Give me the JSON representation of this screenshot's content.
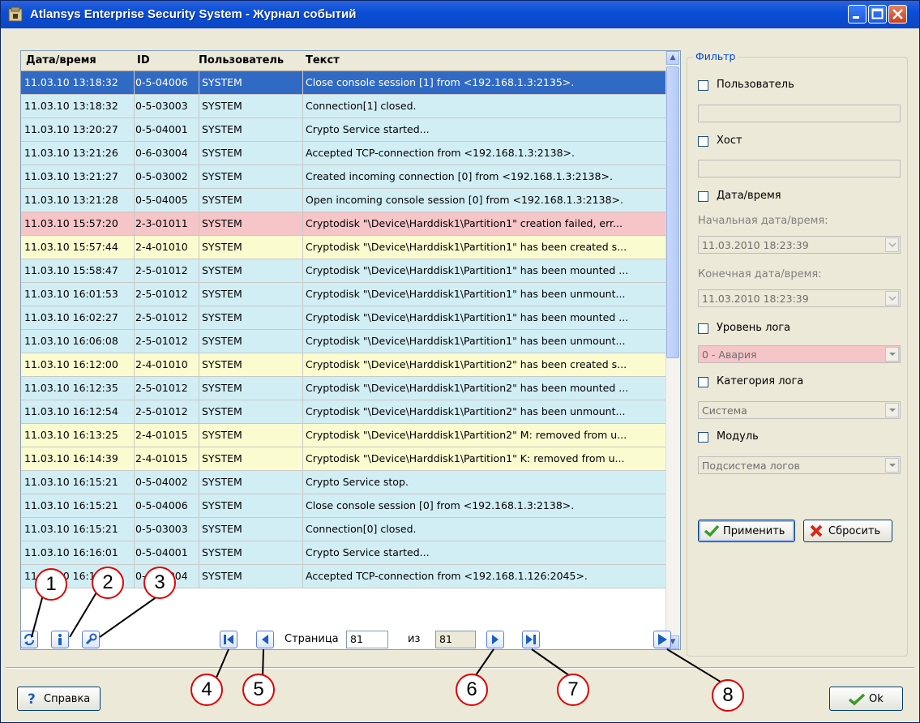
{
  "window": {
    "title": "Atlansys Enterprise Security System - Журнал событий",
    "icon": "app-icon"
  },
  "table": {
    "columns": [
      "Дата/время",
      "ID",
      "Пользователь",
      "Текст"
    ],
    "rows": [
      {
        "datetime": "11.03.10 13:18:32",
        "id": "0-5-04006",
        "user": "SYSTEM",
        "text": "Close console session [1] from <192.168.1.3:2135>.",
        "style": "selected"
      },
      {
        "datetime": "11.03.10 13:18:32",
        "id": "0-5-03003",
        "user": "SYSTEM",
        "text": "Connection[1] closed.",
        "style": "cyan"
      },
      {
        "datetime": "11.03.10 13:20:27",
        "id": "0-5-04001",
        "user": "SYSTEM",
        "text": "Crypto Service started...",
        "style": "cyan"
      },
      {
        "datetime": "11.03.10 13:21:26",
        "id": "0-6-03004",
        "user": "SYSTEM",
        "text": "Accepted TCP-connection from <192.168.1.3:2138>.",
        "style": "cyan"
      },
      {
        "datetime": "11.03.10 13:21:27",
        "id": "0-5-03002",
        "user": "SYSTEM",
        "text": "Created incoming connection [0] from <192.168.1.3:2138>.",
        "style": "cyan"
      },
      {
        "datetime": "11.03.10 13:21:28",
        "id": "0-5-04005",
        "user": "SYSTEM",
        "text": "Open incoming console session [0] from <192.168.1.3:2138>.",
        "style": "cyan"
      },
      {
        "datetime": "11.03.10 15:57:20",
        "id": "2-3-01011",
        "user": "SYSTEM",
        "text": "Cryptodisk \"\\Device\\Harddisk1\\Partition1\" creation failed, err...",
        "style": "pink"
      },
      {
        "datetime": "11.03.10 15:57:44",
        "id": "2-4-01010",
        "user": "SYSTEM",
        "text": "Cryptodisk \"\\Device\\Harddisk1\\Partition1\" has been created s...",
        "style": "yellow"
      },
      {
        "datetime": "11.03.10 15:58:47",
        "id": "2-5-01012",
        "user": "SYSTEM",
        "text": "Cryptodisk \"\\Device\\Harddisk1\\Partition1\" has been mounted ...",
        "style": "cyan"
      },
      {
        "datetime": "11.03.10 16:01:53",
        "id": "2-5-01012",
        "user": "SYSTEM",
        "text": "Cryptodisk \"\\Device\\Harddisk1\\Partition1\" has been unmount...",
        "style": "cyan"
      },
      {
        "datetime": "11.03.10 16:02:27",
        "id": "2-5-01012",
        "user": "SYSTEM",
        "text": "Cryptodisk \"\\Device\\Harddisk1\\Partition1\" has been mounted ...",
        "style": "cyan"
      },
      {
        "datetime": "11.03.10 16:06:08",
        "id": "2-5-01012",
        "user": "SYSTEM",
        "text": "Cryptodisk \"\\Device\\Harddisk1\\Partition1\" has been unmount...",
        "style": "cyan"
      },
      {
        "datetime": "11.03.10 16:12:00",
        "id": "2-4-01010",
        "user": "SYSTEM",
        "text": "Cryptodisk \"\\Device\\Harddisk1\\Partition2\" has been created s...",
        "style": "yellow"
      },
      {
        "datetime": "11.03.10 16:12:35",
        "id": "2-5-01012",
        "user": "SYSTEM",
        "text": "Cryptodisk \"\\Device\\Harddisk1\\Partition2\" has been mounted ...",
        "style": "cyan"
      },
      {
        "datetime": "11.03.10 16:12:54",
        "id": "2-5-01012",
        "user": "SYSTEM",
        "text": "Cryptodisk \"\\Device\\Harddisk1\\Partition2\" has been unmount...",
        "style": "cyan"
      },
      {
        "datetime": "11.03.10 16:13:25",
        "id": "2-4-01015",
        "user": "SYSTEM",
        "text": "Cryptodisk \"\\Device\\Harddisk1\\Partition2\" M: removed from u...",
        "style": "yellow"
      },
      {
        "datetime": "11.03.10 16:14:39",
        "id": "2-4-01015",
        "user": "SYSTEM",
        "text": "Cryptodisk \"\\Device\\Harddisk1\\Partition1\" K: removed from u...",
        "style": "yellow"
      },
      {
        "datetime": "11.03.10 16:15:21",
        "id": "0-5-04002",
        "user": "SYSTEM",
        "text": "Crypto Service stop.",
        "style": "cyan"
      },
      {
        "datetime": "11.03.10 16:15:21",
        "id": "0-5-04006",
        "user": "SYSTEM",
        "text": "Close console session [0] from <192.168.1.3:2138>.",
        "style": "cyan"
      },
      {
        "datetime": "11.03.10 16:15:21",
        "id": "0-5-03003",
        "user": "SYSTEM",
        "text": "Connection[0] closed.",
        "style": "cyan"
      },
      {
        "datetime": "11.03.10 16:16:01",
        "id": "0-5-04001",
        "user": "SYSTEM",
        "text": "Crypto Service started...",
        "style": "cyan"
      },
      {
        "datetime": "11.03.10 16:16:03",
        "id": "0-6-03004",
        "user": "SYSTEM",
        "text": "Accepted TCP-connection from <192.168.1.126:2045>.",
        "style": "cyan"
      }
    ]
  },
  "toolbar": {
    "refresh_icon": "refresh-icon",
    "info_icon": "info-icon",
    "settings_icon": "wrench-icon"
  },
  "pagination": {
    "page_label": "Страница",
    "current_page": "81",
    "of_label": "из",
    "total_pages": "81"
  },
  "filter": {
    "legend": "Фильтр",
    "user_label": "Пользователь",
    "host_label": "Хост",
    "datetime_label": "Дата/время",
    "start_label": "Начальная дата/время:",
    "start_value": "11.03.2010 18:23:39",
    "end_label": "Конечная дата/время:",
    "end_value": "11.03.2010 18:23:39",
    "log_level_label": "Уровень лога",
    "log_level_value": "0 - Авария",
    "log_category_label": "Категория лога",
    "log_category_value": "Система",
    "module_label": "Модуль",
    "module_value": "Подсистема логов",
    "apply_label": "Применить",
    "reset_label": "Сбросить"
  },
  "footer": {
    "help_label": "Справка",
    "ok_label": "Ok"
  },
  "callouts": [
    "1",
    "2",
    "3",
    "4",
    "5",
    "6",
    "7",
    "8"
  ],
  "colors": {
    "selected_row": "#316ac5",
    "normal_row": "#d2eef5",
    "error_row": "#f6c5c8",
    "warning_row": "#fbfbd0",
    "callout_border": "#e00000"
  }
}
